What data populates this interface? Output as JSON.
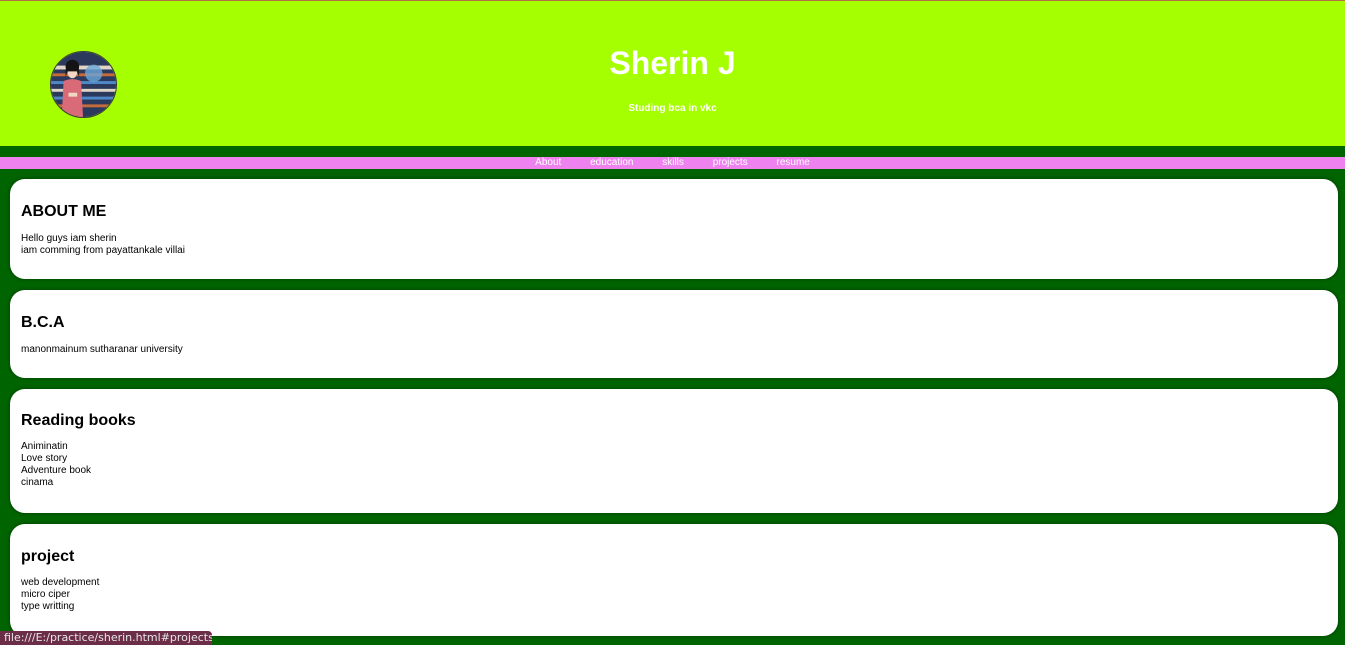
{
  "header": {
    "title": "Sherin J",
    "subtitle": "Studing bca in vkc",
    "avatar_icon": "profile-avatar-anime-girl"
  },
  "nav": {
    "items": [
      {
        "label": "About",
        "href": "#about"
      },
      {
        "label": "education",
        "href": "#education"
      },
      {
        "label": "skills",
        "href": "#skills"
      },
      {
        "label": "projects",
        "href": "#projects"
      },
      {
        "label": "resume",
        "href": "#resume"
      }
    ]
  },
  "sections": {
    "about": {
      "heading": "ABOUT ME",
      "lines": [
        "Hello guys iam sherin",
        "iam comming from payattankale villai"
      ]
    },
    "education": {
      "heading": "B.C.A",
      "lines": [
        "manonmainum sutharanar university"
      ]
    },
    "skills": {
      "heading": "Reading books",
      "lines": [
        "Animinatin",
        "Love story",
        "Adventure book",
        "cinama"
      ]
    },
    "projects": {
      "heading": "project",
      "lines": [
        "web development",
        "micro ciper",
        "type writting"
      ]
    }
  },
  "status": {
    "url": "file:///E:/practice/sherin.html#projects"
  },
  "colors": {
    "header_bg": "#a6ff00",
    "page_bg": "#006400",
    "nav_bg": "#ee82ee",
    "card_bg": "#ffffff"
  }
}
